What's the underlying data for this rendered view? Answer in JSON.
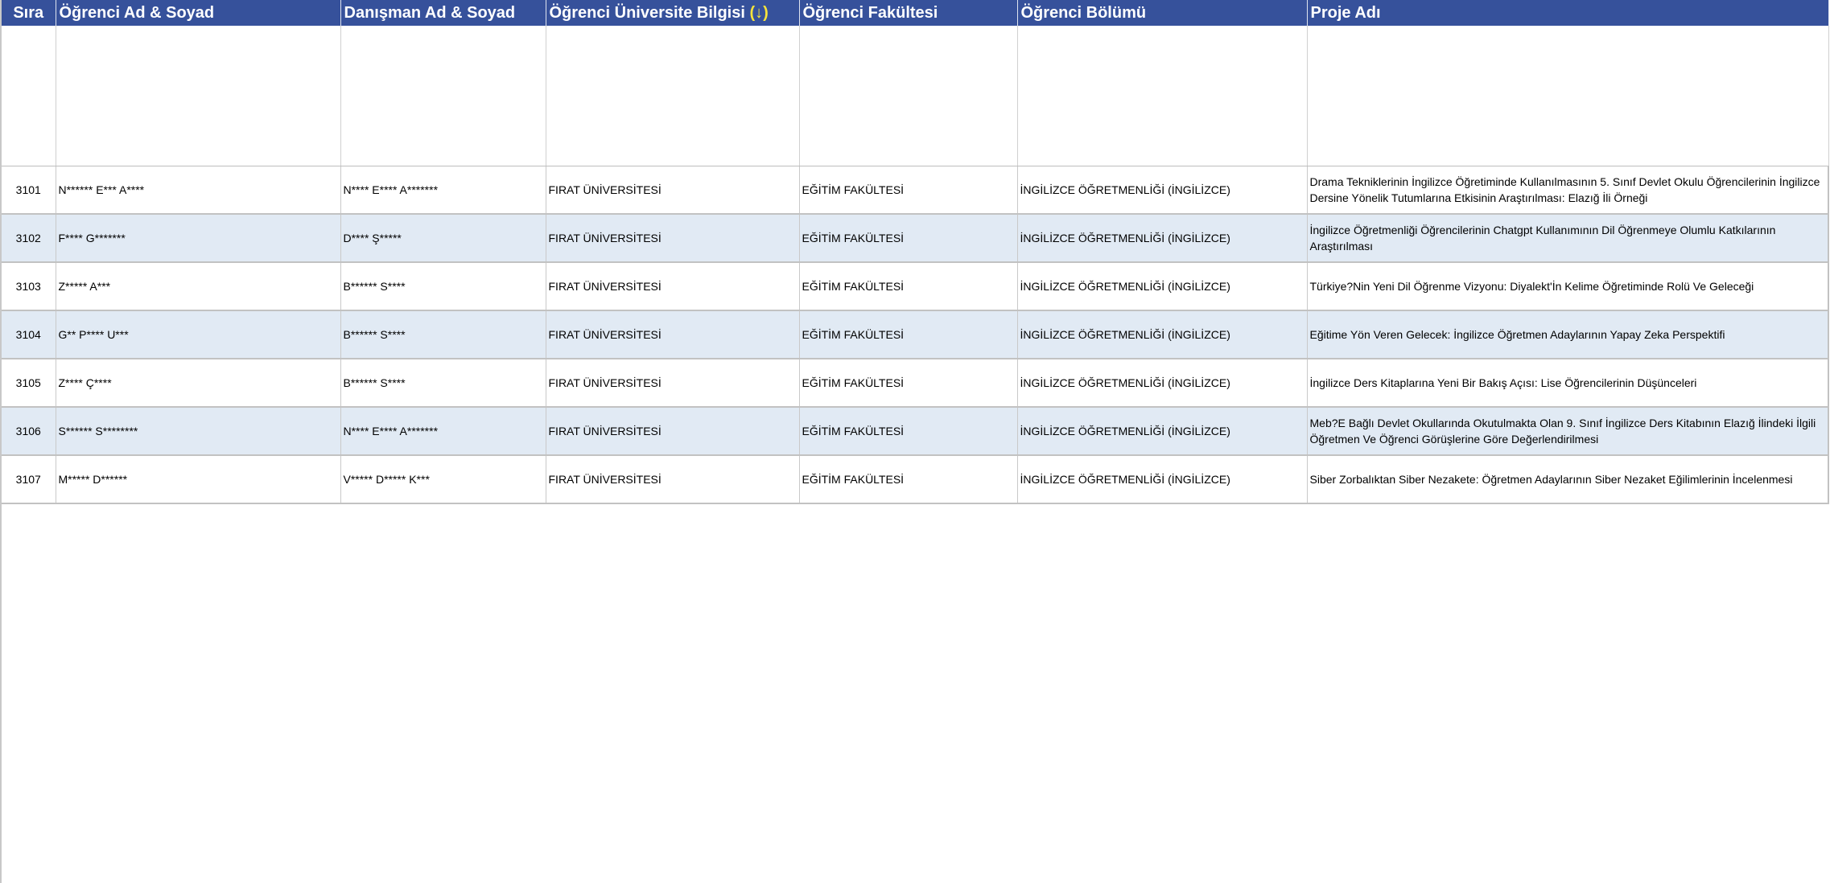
{
  "table": {
    "headers": {
      "sira": "Sıra",
      "ogrenci": "Öğrenci Ad & Soyad",
      "danisman": "Danışman Ad & Soyad",
      "universite": "Öğrenci Üniversite Bilgisi",
      "universite_sort": "(↓)",
      "fakulte": "Öğrenci Fakültesi",
      "bolum": "Öğrenci Bölümü",
      "proje": "Proje Adı"
    },
    "rows": [
      {
        "sira": "3101",
        "ogrenci": "N****** E*** A****",
        "danisman": "N**** E**** A*******",
        "universite": "FIRAT ÜNİVERSİTESİ",
        "fakulte": "EĞİTİM FAKÜLTESİ",
        "bolum": "İNGİLİZCE ÖĞRETMENLİĞİ (İNGİLİZCE)",
        "proje": "Drama Tekniklerinin İngilizce Öğretiminde Kullanılmasının 5. Sınıf Devlet Okulu Öğrencilerinin İngilizce Dersine Yönelik Tutumlarına Etkisinin Araştırılması: Elazığ İli Örneği"
      },
      {
        "sira": "3102",
        "ogrenci": "F**** G*******",
        "danisman": "D**** Ş*****",
        "universite": "FIRAT ÜNİVERSİTESİ",
        "fakulte": "EĞİTİM FAKÜLTESİ",
        "bolum": "İNGİLİZCE ÖĞRETMENLİĞİ (İNGİLİZCE)",
        "proje": "İngilizce Öğretmenliği Öğrencilerinin Chatgpt Kullanımının Dil Öğrenmeye Olumlu Katkılarının Araştırılması"
      },
      {
        "sira": "3103",
        "ogrenci": "Z***** A***",
        "danisman": "B****** S****",
        "universite": "FIRAT ÜNİVERSİTESİ",
        "fakulte": "EĞİTİM FAKÜLTESİ",
        "bolum": "İNGİLİZCE ÖĞRETMENLİĞİ (İNGİLİZCE)",
        "proje": "Türkiye?Nin Yeni Dil Öğrenme Vizyonu: Diyalekt'İn Kelime Öğretiminde Rolü Ve Geleceği"
      },
      {
        "sira": "3104",
        "ogrenci": "G** P**** U***",
        "danisman": "B****** S****",
        "universite": "FIRAT ÜNİVERSİTESİ",
        "fakulte": "EĞİTİM FAKÜLTESİ",
        "bolum": "İNGİLİZCE ÖĞRETMENLİĞİ (İNGİLİZCE)",
        "proje": "Eğitime Yön Veren Gelecek: İngilizce Öğretmen Adaylarının Yapay Zeka Perspektifi"
      },
      {
        "sira": "3105",
        "ogrenci": "Z**** Ç****",
        "danisman": "B****** S****",
        "universite": "FIRAT ÜNİVERSİTESİ",
        "fakulte": "EĞİTİM FAKÜLTESİ",
        "bolum": "İNGİLİZCE ÖĞRETMENLİĞİ (İNGİLİZCE)",
        "proje": "İngilizce Ders Kitaplarına Yeni Bir Bakış Açısı: Lise Öğrencilerinin Düşünceleri"
      },
      {
        "sira": "3106",
        "ogrenci": "S****** S********",
        "danisman": "N**** E**** A*******",
        "universite": "FIRAT ÜNİVERSİTESİ",
        "fakulte": "EĞİTİM FAKÜLTESİ",
        "bolum": "İNGİLİZCE ÖĞRETMENLİĞİ (İNGİLİZCE)",
        "proje": "Meb?E Bağlı Devlet Okullarında Okutulmakta Olan 9. Sınıf İngilizce Ders Kitabının Elazığ İlindeki İlgili Öğretmen Ve Öğrenci Görüşlerine Göre Değerlendirilmesi"
      },
      {
        "sira": "3107",
        "ogrenci": "M***** D******",
        "danisman": "V***** D***** K***",
        "universite": "FIRAT ÜNİVERSİTESİ",
        "fakulte": "EĞİTİM FAKÜLTESİ",
        "bolum": "İNGİLİZCE ÖĞRETMENLİĞİ (İNGİLİZCE)",
        "proje": "Siber Zorbalıktan Siber Nezakete: Öğretmen Adaylarının Siber Nezaket Eğilimlerinin İncelenmesi"
      }
    ]
  },
  "colors": {
    "header_bg": "#36519b",
    "header_text": "#ffffff",
    "sort_icon": "#f7e33b",
    "alt_row_bg": "#e1eaf4"
  }
}
